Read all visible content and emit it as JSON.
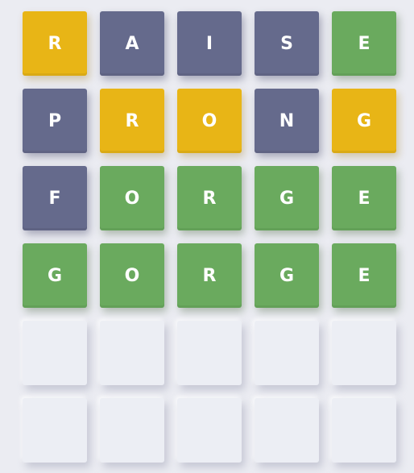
{
  "board": {
    "rows": [
      [
        {
          "letter": "R",
          "state": "present"
        },
        {
          "letter": "A",
          "state": "absent"
        },
        {
          "letter": "I",
          "state": "absent"
        },
        {
          "letter": "S",
          "state": "absent"
        },
        {
          "letter": "E",
          "state": "correct"
        }
      ],
      [
        {
          "letter": "P",
          "state": "absent"
        },
        {
          "letter": "R",
          "state": "present"
        },
        {
          "letter": "O",
          "state": "present"
        },
        {
          "letter": "N",
          "state": "absent"
        },
        {
          "letter": "G",
          "state": "present"
        }
      ],
      [
        {
          "letter": "F",
          "state": "absent"
        },
        {
          "letter": "O",
          "state": "correct"
        },
        {
          "letter": "R",
          "state": "correct"
        },
        {
          "letter": "G",
          "state": "correct"
        },
        {
          "letter": "E",
          "state": "correct"
        }
      ],
      [
        {
          "letter": "G",
          "state": "correct"
        },
        {
          "letter": "O",
          "state": "correct"
        },
        {
          "letter": "R",
          "state": "correct"
        },
        {
          "letter": "G",
          "state": "correct"
        },
        {
          "letter": "E",
          "state": "correct"
        }
      ],
      [
        {
          "letter": "",
          "state": "empty"
        },
        {
          "letter": "",
          "state": "empty"
        },
        {
          "letter": "",
          "state": "empty"
        },
        {
          "letter": "",
          "state": "empty"
        },
        {
          "letter": "",
          "state": "empty"
        }
      ],
      [
        {
          "letter": "",
          "state": "empty"
        },
        {
          "letter": "",
          "state": "empty"
        },
        {
          "letter": "",
          "state": "empty"
        },
        {
          "letter": "",
          "state": "empty"
        },
        {
          "letter": "",
          "state": "empty"
        }
      ]
    ]
  },
  "colors": {
    "correct": "#6aaa5e",
    "present": "#e8b516",
    "absent": "#656a8c",
    "empty": "#eceef4",
    "background": "#ebecf2"
  }
}
